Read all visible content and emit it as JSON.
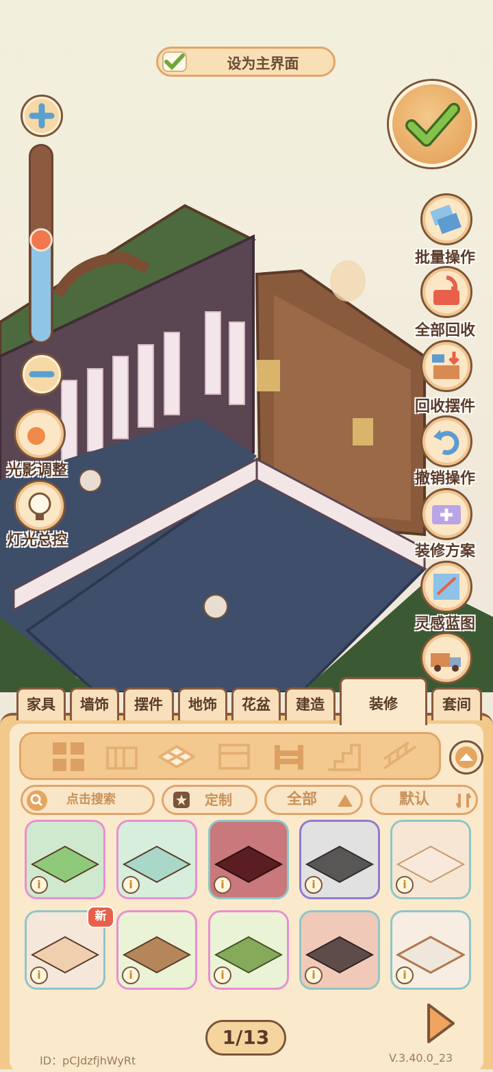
{
  "top_button": {
    "label": "设为主界面"
  },
  "left_controls": {
    "light_adjust": "光影调整",
    "light_master": "灯光总控"
  },
  "right_menu": [
    {
      "label": "批量操作",
      "icon": "batch-icon"
    },
    {
      "label": "全部回收",
      "icon": "recall-all-icon"
    },
    {
      "label": "回收摆件",
      "icon": "recall-item-icon"
    },
    {
      "label": "撤销操作",
      "icon": "undo-icon"
    },
    {
      "label": "装修方案",
      "icon": "plan-icon"
    },
    {
      "label": "灵感蓝图",
      "icon": "blueprint-icon"
    }
  ],
  "tabs": [
    "家具",
    "墙饰",
    "摆件",
    "地饰",
    "花盆",
    "建造",
    "装修",
    "套间"
  ],
  "active_tab": "装修",
  "search": {
    "placeholder": "点击搜索"
  },
  "filters": {
    "custom": "定制",
    "all": "全部",
    "sort": "默认"
  },
  "items": [
    {
      "badge": "",
      "info": "i"
    },
    {
      "badge": "",
      "info": "i"
    },
    {
      "badge": "",
      "info": "i"
    },
    {
      "badge": "",
      "info": "i"
    },
    {
      "badge": "",
      "info": "i"
    },
    {
      "badge": "新",
      "info": "i"
    },
    {
      "badge": "",
      "info": "i"
    },
    {
      "badge": "",
      "info": "i"
    },
    {
      "badge": "",
      "info": "i"
    },
    {
      "badge": "",
      "info": "i"
    }
  ],
  "pagination": {
    "label": "1/13"
  },
  "footer": {
    "id": "ID：pCJdzfjhWyRt",
    "version": "V.3.40.0_23"
  },
  "colors": {
    "accent": "#e2a468",
    "dark": "#7a5539",
    "panel": "#f2c98a"
  }
}
